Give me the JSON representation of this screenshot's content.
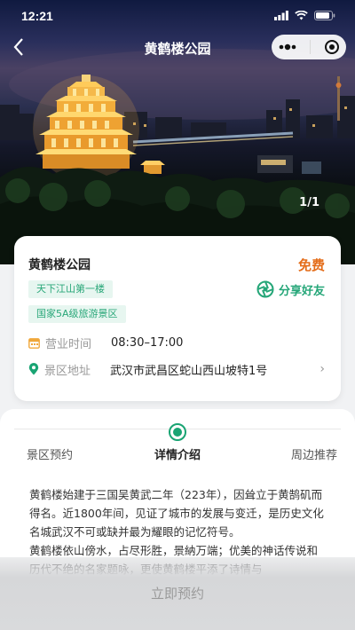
{
  "status_bar": {
    "time": "12:21"
  },
  "nav": {
    "title": "黄鹤楼公园"
  },
  "hero": {
    "image_counter": "1/1"
  },
  "info": {
    "name": "黄鹤楼公园",
    "price": "免费",
    "tags": [
      "天下江山第一楼",
      "国家5A级旅游景区"
    ],
    "share_label": "分享好友",
    "hours_label": "营业时间",
    "hours_value": "08:30–17:00",
    "address_label": "景区地址",
    "address_value": "武汉市武昌区蛇山西山坡特1号"
  },
  "tabs": [
    {
      "label": "景区预约"
    },
    {
      "label": "详情介绍",
      "active": true
    },
    {
      "label": "周边推荐"
    }
  ],
  "description": {
    "line1": "黄鹤楼始建于三国吴黄武二年（223年），因耸立于黄鹄矶而得名。近1800年间，见证了城市的发展与变迁，是历史文化名城武汉不可或缺并最为耀眼的记忆符号。",
    "line2": "黄鹤楼依山傍水，占尽形胜，景納万端；优美的神话传说和历代不绝的名家题咏，更使黄鹤楼平添了诗情与"
  },
  "bottom": {
    "book_label": "立即预约"
  },
  "colors": {
    "accent_green": "#19a473",
    "price_orange": "#e46d1a"
  }
}
